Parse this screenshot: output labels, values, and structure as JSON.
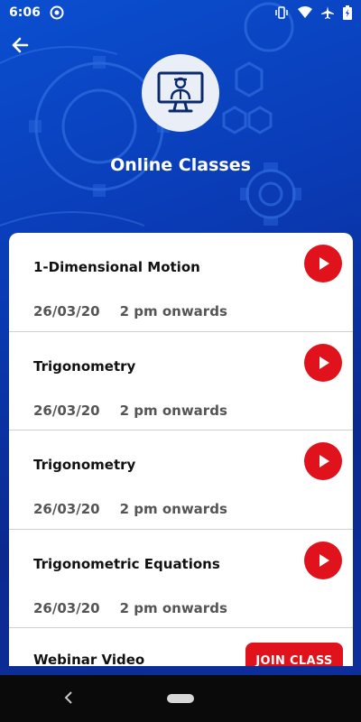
{
  "status_bar": {
    "time": "6:06",
    "icons": [
      "sync-icon",
      "vibrate-icon",
      "wifi-icon",
      "airplane-icon",
      "battery-icon"
    ]
  },
  "header": {
    "title": "Online Classes",
    "hero_icon": "teacher-monitor-icon"
  },
  "classes": [
    {
      "title": "1-Dimensional Motion",
      "date": "26/03/20",
      "time": "2 pm onwards"
    },
    {
      "title": "Trigonometry",
      "date": "26/03/20",
      "time": "2 pm onwards"
    },
    {
      "title": "Trigonometry",
      "date": "26/03/20",
      "time": "2 pm onwards"
    },
    {
      "title": "Trigonometric Equations",
      "date": "26/03/20",
      "time": "2 pm onwards"
    }
  ],
  "webinar": {
    "title": "Webinar Video",
    "join_label": "JOIN CLASS"
  },
  "colors": {
    "accent_red": "#e0131d",
    "background_blue": "#0a3ab4"
  }
}
